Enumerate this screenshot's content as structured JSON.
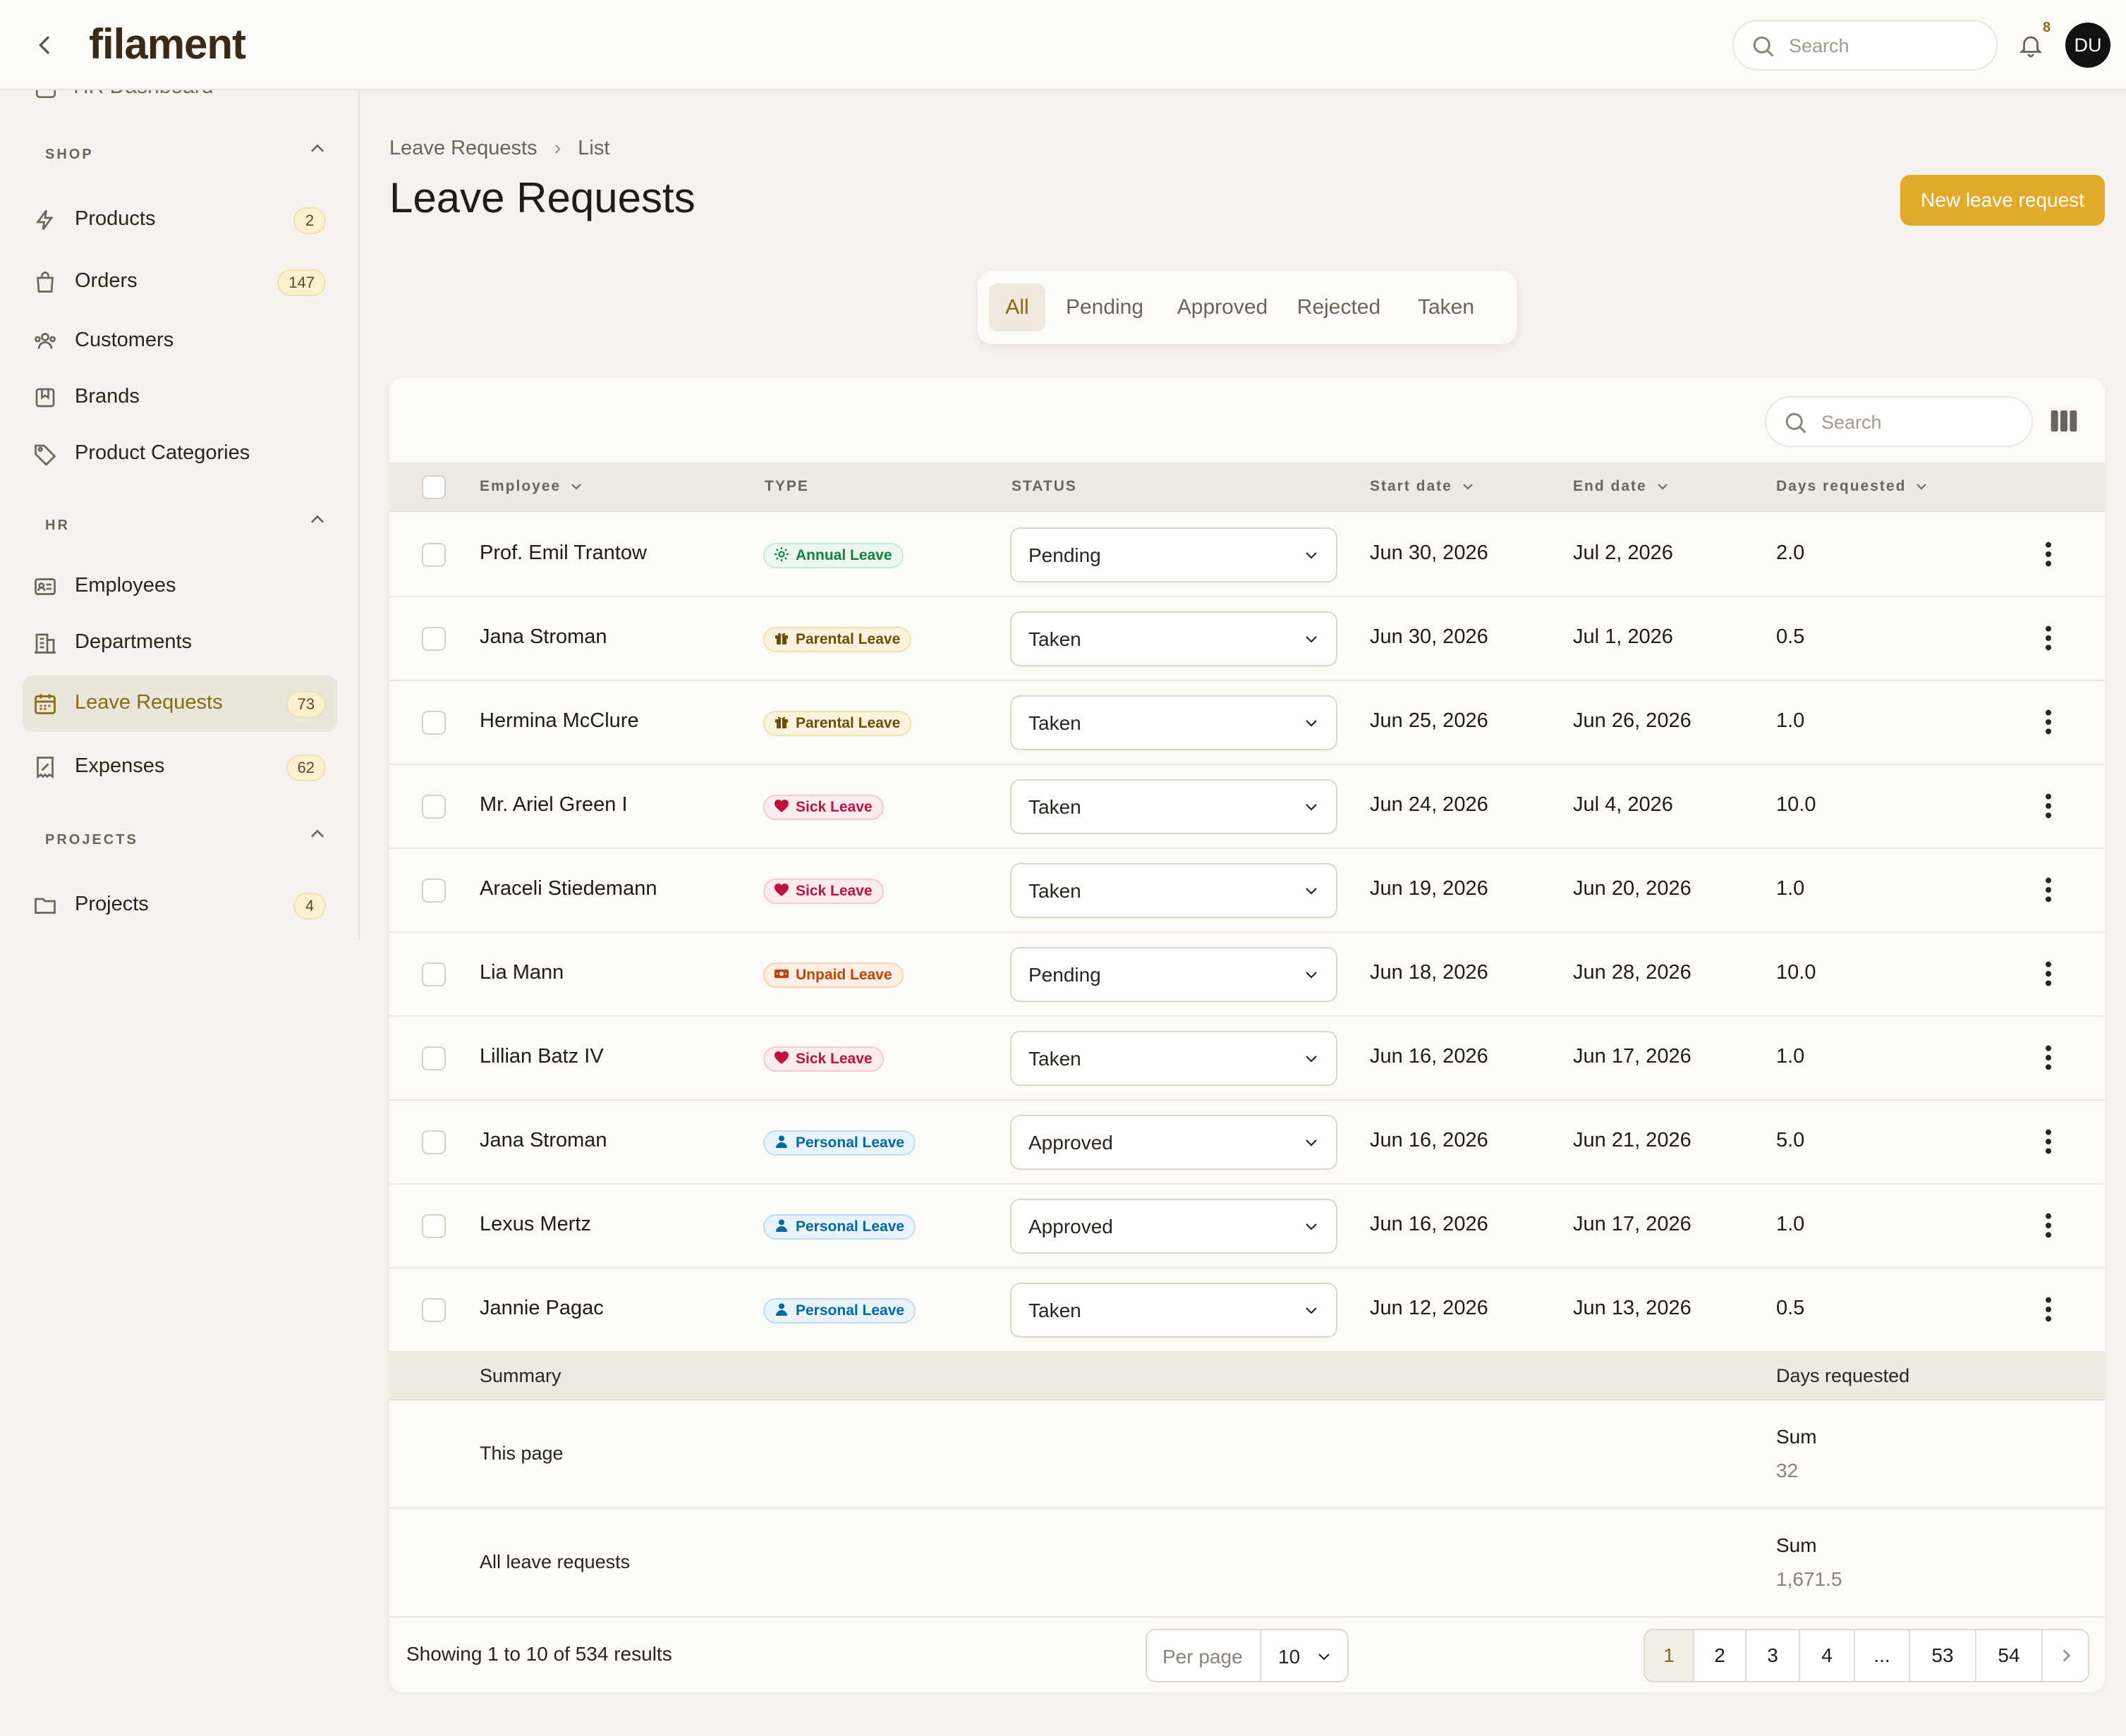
{
  "app": {
    "logo": "filament"
  },
  "topbar": {
    "search_placeholder": "Search",
    "notification_count": "8",
    "avatar_initials": "DU"
  },
  "sidebar": {
    "cut_item": "HR Dashboard",
    "groups": [
      {
        "label": "SHOP",
        "items": [
          {
            "label": "Products",
            "count": "2",
            "icon": "bolt-icon"
          },
          {
            "label": "Orders",
            "count": "147",
            "icon": "shopping-bag-icon"
          },
          {
            "label": "Customers",
            "count": "",
            "icon": "users-icon"
          },
          {
            "label": "Brands",
            "count": "",
            "icon": "bookmark-square-icon"
          },
          {
            "label": "Product Categories",
            "count": "",
            "icon": "tag-icon"
          }
        ]
      },
      {
        "label": "HR",
        "items": [
          {
            "label": "Employees",
            "count": "",
            "icon": "id-card-icon"
          },
          {
            "label": "Departments",
            "count": "",
            "icon": "building-icon"
          },
          {
            "label": "Leave Requests",
            "count": "73",
            "icon": "calendar-icon",
            "active": true
          },
          {
            "label": "Expenses",
            "count": "62",
            "icon": "receipt-icon"
          }
        ]
      },
      {
        "label": "PROJECTS",
        "items": [
          {
            "label": "Projects",
            "count": "4",
            "icon": "folder-icon"
          }
        ]
      }
    ]
  },
  "breadcrumb": {
    "parent": "Leave Requests",
    "current": "List"
  },
  "page": {
    "title": "Leave Requests",
    "new_button": "New leave request"
  },
  "tabs": [
    {
      "label": "All",
      "active": true
    },
    {
      "label": "Pending"
    },
    {
      "label": "Approved"
    },
    {
      "label": "Rejected"
    },
    {
      "label": "Taken"
    }
  ],
  "table": {
    "search_placeholder": "Search",
    "columns": {
      "employee": "Employee",
      "type": "TYPE",
      "status": "STATUS",
      "start": "Start date",
      "end": "End date",
      "days": "Days requested"
    },
    "rows": [
      {
        "employee": "Prof. Emil Trantow",
        "type": "Annual Leave",
        "type_kind": "annual",
        "status": "Pending",
        "start": "Jun 30, 2026",
        "end": "Jul 2, 2026",
        "days": "2.0"
      },
      {
        "employee": "Jana Stroman",
        "type": "Parental Leave",
        "type_kind": "parental",
        "status": "Taken",
        "start": "Jun 30, 2026",
        "end": "Jul 1, 2026",
        "days": "0.5"
      },
      {
        "employee": "Hermina McClure",
        "type": "Parental Leave",
        "type_kind": "parental",
        "status": "Taken",
        "start": "Jun 25, 2026",
        "end": "Jun 26, 2026",
        "days": "1.0"
      },
      {
        "employee": "Mr. Ariel Green I",
        "type": "Sick Leave",
        "type_kind": "sick",
        "status": "Taken",
        "start": "Jun 24, 2026",
        "end": "Jul 4, 2026",
        "days": "10.0"
      },
      {
        "employee": "Araceli Stiedemann",
        "type": "Sick Leave",
        "type_kind": "sick",
        "status": "Taken",
        "start": "Jun 19, 2026",
        "end": "Jun 20, 2026",
        "days": "1.0"
      },
      {
        "employee": "Lia Mann",
        "type": "Unpaid Leave",
        "type_kind": "unpaid",
        "status": "Pending",
        "start": "Jun 18, 2026",
        "end": "Jun 28, 2026",
        "days": "10.0"
      },
      {
        "employee": "Lillian Batz IV",
        "type": "Sick Leave",
        "type_kind": "sick",
        "status": "Taken",
        "start": "Jun 16, 2026",
        "end": "Jun 17, 2026",
        "days": "1.0"
      },
      {
        "employee": "Jana Stroman",
        "type": "Personal Leave",
        "type_kind": "personal",
        "status": "Approved",
        "start": "Jun 16, 2026",
        "end": "Jun 21, 2026",
        "days": "5.0"
      },
      {
        "employee": "Lexus Mertz",
        "type": "Personal Leave",
        "type_kind": "personal",
        "status": "Approved",
        "start": "Jun 16, 2026",
        "end": "Jun 17, 2026",
        "days": "1.0"
      },
      {
        "employee": "Jannie Pagac",
        "type": "Personal Leave",
        "type_kind": "personal",
        "status": "Taken",
        "start": "Jun 12, 2026",
        "end": "Jun 13, 2026",
        "days": "0.5"
      }
    ]
  },
  "summary": {
    "label": "Summary",
    "column": "Days requested",
    "this_page": {
      "label": "This page",
      "key": "Sum",
      "value": "32"
    },
    "all": {
      "label": "All leave requests",
      "key": "Sum",
      "value": "1,671.5"
    }
  },
  "footer": {
    "showing": "Showing 1 to 10 of 534 results",
    "per_page_label": "Per page",
    "per_page_value": "10",
    "pages": [
      "1",
      "2",
      "3",
      "4",
      "...",
      "53",
      "54"
    ],
    "current_page": "1"
  }
}
